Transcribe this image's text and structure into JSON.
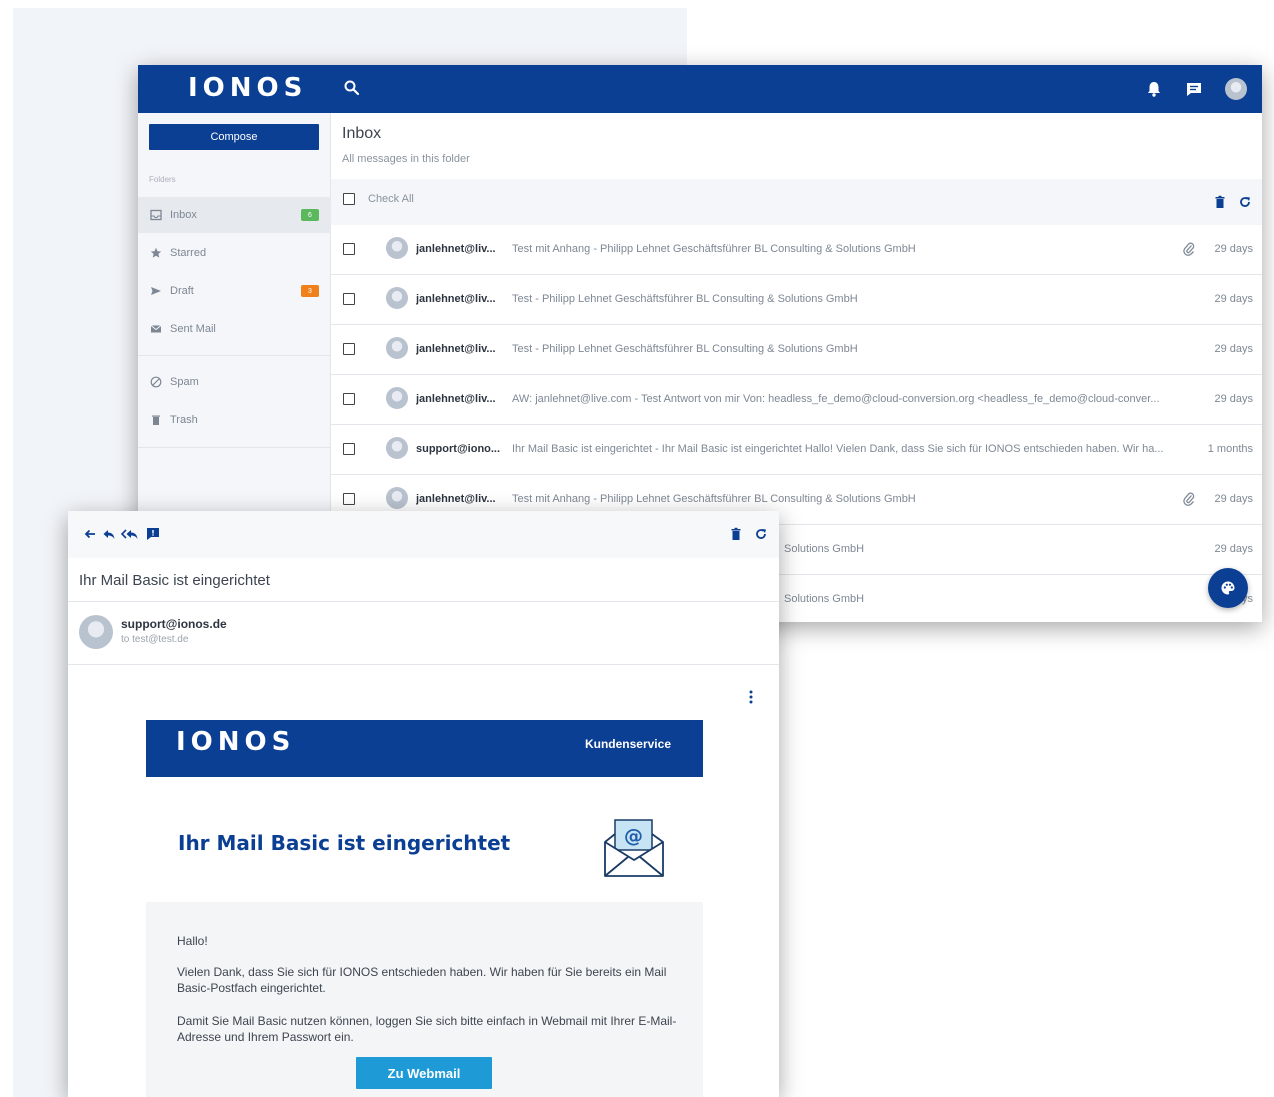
{
  "app": {
    "logo": "IONOS",
    "compose_label": "Compose",
    "folders_label": "Folders",
    "folders": [
      {
        "label": "Inbox",
        "badge": "6",
        "badge_color": "#5cb85c",
        "icon": "inbox-icon"
      },
      {
        "label": "Starred",
        "badge": "",
        "icon": "star-icon"
      },
      {
        "label": "Draft",
        "badge": "3",
        "badge_color": "#f0801a",
        "icon": "send-icon"
      },
      {
        "label": "Sent Mail",
        "badge": "",
        "icon": "envelope-icon"
      },
      {
        "label": "Spam",
        "badge": "",
        "icon": "spam-icon"
      },
      {
        "label": "Trash",
        "badge": "",
        "icon": "trash-icon"
      }
    ],
    "inbox_title": "Inbox",
    "inbox_subtitle": "All messages in this folder",
    "check_all_label": "Check All",
    "messages": [
      {
        "sender": "janlehnet@liv...",
        "subject": "Test mit Anhang - Philipp Lehnet Geschäftsführer BL Consulting & Solutions GmbH",
        "attachment": true,
        "date": "29 days"
      },
      {
        "sender": "janlehnet@liv...",
        "subject": "Test - Philipp Lehnet Geschäftsführer BL Consulting & Solutions GmbH",
        "attachment": false,
        "date": "29 days"
      },
      {
        "sender": "janlehnet@liv...",
        "subject": "Test - Philipp Lehnet Geschäftsführer BL Consulting & Solutions GmbH",
        "attachment": false,
        "date": "29 days"
      },
      {
        "sender": "janlehnet@liv...",
        "subject": "AW: janlehnet@live.com - Test Antwort von mir Von: headless_fe_demo@cloud-conversion.org <headless_fe_demo@cloud-conver...",
        "attachment": false,
        "date": "29 days"
      },
      {
        "sender": "support@iono...",
        "subject": "Ihr Mail Basic ist eingerichtet - Ihr Mail Basic ist eingerichtet Hallo! Vielen Dank, dass Sie sich für IONOS entschieden haben. Wir ha...",
        "attachment": false,
        "date": "1 months"
      },
      {
        "sender": "janlehnet@liv...",
        "subject": "Test mit Anhang - Philipp Lehnet Geschäftsführer BL Consulting & Solutions GmbH",
        "attachment": true,
        "date": "29 days"
      },
      {
        "sender": "",
        "subject": "Solutions GmbH",
        "attachment": false,
        "date": "29 days"
      },
      {
        "sender": "",
        "subject": "Solutions GmbH",
        "attachment": false,
        "date": "ys"
      }
    ],
    "colors": {
      "brand": "#0b3f94",
      "accent_button": "#1e9bd7"
    }
  },
  "reader": {
    "subject": "Ihr Mail Basic ist eingerichtet",
    "from": "support@ionos.de",
    "to": "to test@test.de",
    "email_body": {
      "header_logo": "IONOS",
      "header_link": "Kundenservice",
      "headline": "Ihr Mail Basic ist eingerichtet",
      "greeting": "Hallo!",
      "paragraph1": "Vielen Dank, dass Sie sich für IONOS entschieden haben. Wir haben für Sie bereits ein Mail Basic-Postfach eingerichtet.",
      "paragraph2": "Damit Sie Mail Basic nutzen können, loggen Sie sich bitte einfach in Webmail mit Ihrer E-Mail-Adresse und Ihrem Passwort ein.",
      "button_label": "Zu Webmail"
    }
  }
}
